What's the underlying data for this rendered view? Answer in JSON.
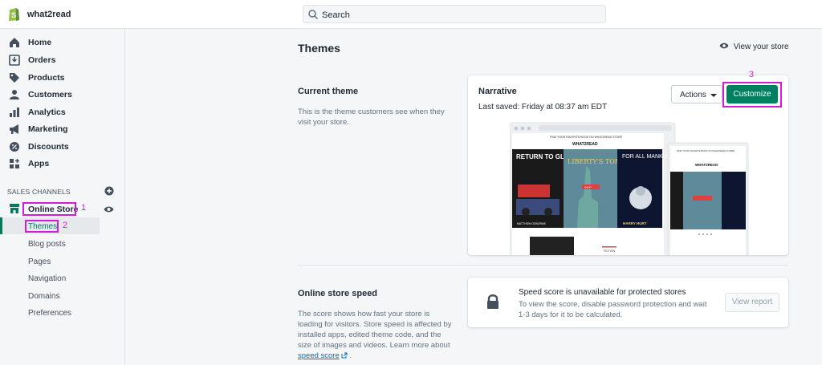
{
  "topbar": {
    "store_name": "what2read",
    "search_placeholder": "Search"
  },
  "sidebar": {
    "items": [
      {
        "label": "Home",
        "icon": "home-icon"
      },
      {
        "label": "Orders",
        "icon": "orders-icon"
      },
      {
        "label": "Products",
        "icon": "tag-icon"
      },
      {
        "label": "Customers",
        "icon": "person-icon"
      },
      {
        "label": "Analytics",
        "icon": "bar-chart-icon"
      },
      {
        "label": "Marketing",
        "icon": "megaphone-icon"
      },
      {
        "label": "Discounts",
        "icon": "discount-icon"
      },
      {
        "label": "Apps",
        "icon": "apps-icon"
      }
    ],
    "section_label": "SALES CHANNELS",
    "channel": {
      "label": "Online Store",
      "icon": "store-icon"
    },
    "subitems": [
      "Themes",
      "Blog posts",
      "Pages",
      "Navigation",
      "Domains",
      "Preferences"
    ]
  },
  "annotations": {
    "one": "1",
    "two": "2",
    "three": "3",
    "color": "#d11bd6"
  },
  "main": {
    "title": "Themes",
    "view_store": "View your store",
    "current_theme": {
      "heading": "Current theme",
      "description": "This is the theme customers see when they visit your store.",
      "name": "Narrative",
      "last_saved": "Last saved: Friday at 08:37 am EDT",
      "actions_label": "Actions",
      "customize_label": "Customize",
      "preview": {
        "desktop_brand": "WHAT2READ",
        "mobile_brand": "WHAT2READ",
        "mobile_banner": "FIND YOUR FAVORITE BOOK ON WHAT2READ STORE",
        "book1_title": "RETURN TO GLORY",
        "book1_author": "MATTHEW OSBORNE",
        "book2_title": "LIBERTY'S TORCH",
        "book3_title": "FOR ALL MANKIND",
        "book3_author": "HARRY HURT",
        "shop_label": "SHOP",
        "footer_label": "FICTION"
      }
    },
    "speed": {
      "heading": "Online store speed",
      "description": "The score shows how fast your store is loading for visitors. Store speed is affected by installed apps, edited theme code, and the size of images and videos. Learn more about",
      "link_text": "speed score",
      "after_link": ".",
      "card_title": "Speed score is unavailable for protected stores",
      "card_desc": "To view the score, disable password protection and wait 1-3 days for it to be calculated.",
      "report_label": "View report"
    }
  },
  "colors": {
    "accent": "#008060",
    "highlight": "#d11bd6",
    "link": "#006fbb"
  }
}
